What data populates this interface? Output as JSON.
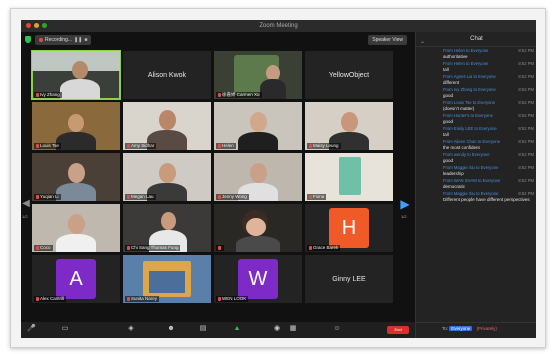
{
  "window": {
    "title": "Zoom Meeting"
  },
  "topbar": {
    "recording": "Recording...",
    "view_button": "Speaker View"
  },
  "tiles": [
    {
      "name": "Ivy Zhang"
    },
    {
      "name": "Alison Kwok"
    },
    {
      "name": "徐嘉婷 Carmen Xu"
    },
    {
      "name": "YellowObject"
    },
    {
      "name": "Louis Tse"
    },
    {
      "name": "Amy Sidhar"
    },
    {
      "name": "Helen"
    },
    {
      "name": "Maisy Leung"
    },
    {
      "name": "Yuqian Li"
    },
    {
      "name": "Megan Lau"
    },
    {
      "name": "Jenny Wong"
    },
    {
      "name": "Fiona"
    },
    {
      "name": "Coco"
    },
    {
      "name": "Chi Sang Thomas Fung"
    },
    {
      "name": ""
    },
    {
      "name": "Grace Barek"
    },
    {
      "name": "Alex Cantrill"
    },
    {
      "name": "Sunita Narey"
    },
    {
      "name": "WEN LOOK"
    },
    {
      "name": "Ginny LEE"
    }
  ],
  "avatars": {
    "h": "H",
    "a": "A",
    "w": "W"
  },
  "pager": {
    "left": "1/2",
    "right": "1/2"
  },
  "chat": {
    "title": "Chat",
    "messages": [
      {
        "from": "From Helen to Everyone",
        "time": "8:52 PM",
        "text": "authoritative"
      },
      {
        "from": "From Helen to Everyone",
        "time": "8:52 PM",
        "text": "tall"
      },
      {
        "from": "From Agnes Lai to Everyone",
        "time": "8:52 PM",
        "text": "different"
      },
      {
        "from": "From Ivy Zhang to Everyone",
        "time": "8:52 PM",
        "text": "good"
      },
      {
        "from": "From Louis Tse to Everyone",
        "time": "8:52 PM",
        "text": "(doesn't matter)"
      },
      {
        "from": "From Hunter's to Everyone",
        "time": "8:52 PM",
        "text": "good"
      },
      {
        "from": "From Emily LEE to Everyone",
        "time": "8:52 PM",
        "text": "tall"
      },
      {
        "from": "From Aileen Chan to Everyone",
        "time": "8:52 PM",
        "text": "the most confident"
      },
      {
        "from": "From wendy to Everyone",
        "time": "8:52 PM",
        "text": "good"
      },
      {
        "from": "From Maggie Siu to Everyone",
        "time": "8:52 PM",
        "text": "leadership"
      },
      {
        "from": "From WAN SHAM to Everyone",
        "time": "8:52 PM",
        "text": "democratic"
      },
      {
        "from": "From Maggie Siu to Everyone",
        "time": "8:52 PM",
        "text": "Different people have different perspectives"
      }
    ],
    "to_label": "To:",
    "to_value": "Everyone",
    "to_private": "(Privately)"
  },
  "toolbar": {
    "end": "End"
  }
}
